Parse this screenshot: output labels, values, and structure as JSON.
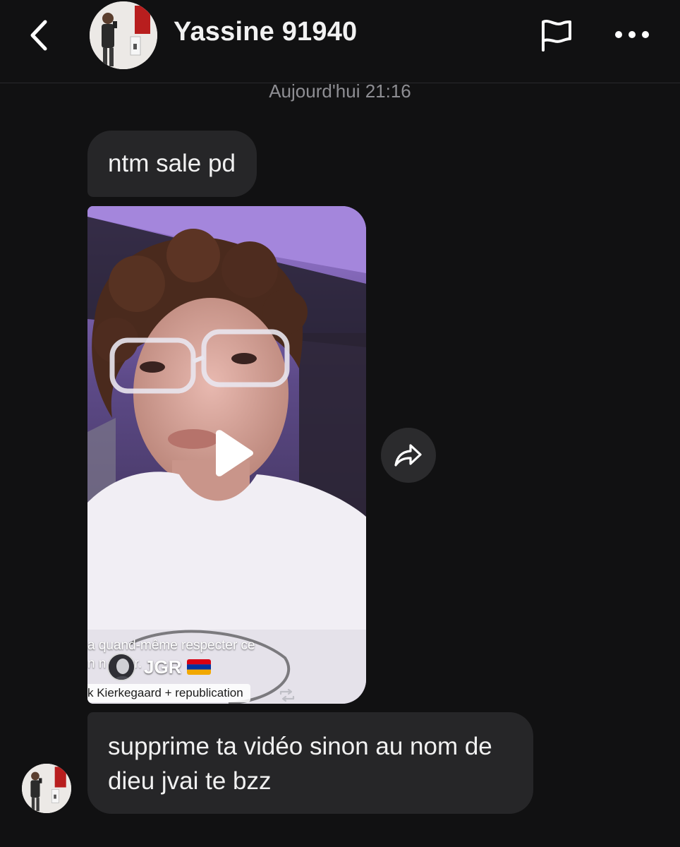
{
  "header": {
    "username": "Yassine 91940",
    "icons": {
      "back": "chevron-left-icon",
      "report": "flag-icon",
      "more": "more-horizontal-icon"
    }
  },
  "conversation": {
    "timestamp": "Aujourd'hui 21:16",
    "messages": [
      {
        "type": "text",
        "text": "ntm sale pd"
      },
      {
        "type": "video",
        "caption_line_1": "a quand-même respecter ce",
        "caption_line_2": "n n               ss      er.",
        "creator": "JGR",
        "creator_flag": "armenia-flag",
        "sound": "k Kierkegaard + republication"
      },
      {
        "type": "text",
        "text": "supprime ta vidéo sinon au nom de  dieu jvai te bzz"
      }
    ]
  },
  "colors": {
    "background": "#111112",
    "bubble": "#262628",
    "timestamp": "#8e8e93"
  }
}
